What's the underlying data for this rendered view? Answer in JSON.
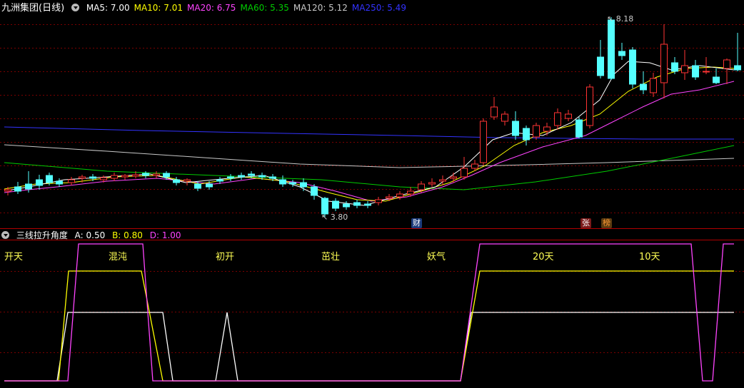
{
  "main_header": {
    "title": "九洲集团(日线)",
    "ma_values": [
      {
        "label": "MA5: 7.00",
        "color": "#ffffff"
      },
      {
        "label": "MA10: 7.01",
        "color": "#ffff00"
      },
      {
        "label": "MA20: 6.75",
        "color": "#ff44ff"
      },
      {
        "label": "MA60: 5.35",
        "color": "#00cc00"
      },
      {
        "label": "MA120: 5.12",
        "color": "#c8c8c8"
      },
      {
        "label": "MA250: 5.49",
        "color": "#3333ff"
      }
    ]
  },
  "price_labels": {
    "high": "8.18",
    "low": "3.80"
  },
  "event_tags": [
    {
      "text": "财",
      "fg": "#ffffff",
      "bg": "#1a3a7a"
    },
    {
      "text": "张",
      "fg": "#ffffff",
      "bg": "#7a1a1a"
    },
    {
      "text": "榜",
      "fg": "#ff9933",
      "bg": "#5a3a10"
    }
  ],
  "indicator_header": {
    "title": "三线拉升角度",
    "a": "A: 0.50",
    "b": "B: 0.80",
    "d": "D: 1.00",
    "colors": {
      "a": "#ffffff",
      "b": "#ffff00",
      "d": "#ff44ff"
    }
  },
  "phases": [
    "开天",
    "混沌",
    "初开",
    "茁壮",
    "妖气",
    "20天",
    "10天"
  ],
  "colors": {
    "up": "#ff3333",
    "down": "#55ffff",
    "grid": "#7a0000",
    "border": "#b00000"
  }
}
